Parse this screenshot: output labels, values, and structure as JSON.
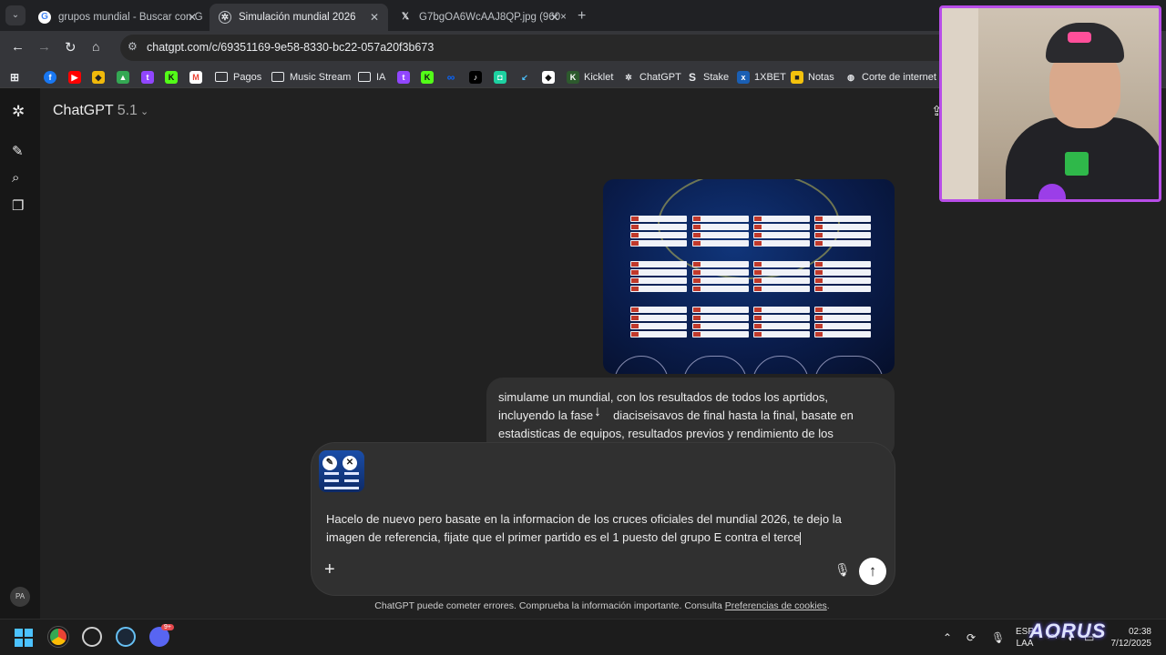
{
  "tabs": [
    {
      "title": "grupos mundial - Buscar con G",
      "favicon": "google-icon"
    },
    {
      "title": "Simulación mundial 2026",
      "favicon": "chatgpt-icon"
    },
    {
      "title": "G7bgOA6WcAAJ8QP.jpg (960×",
      "favicon": "x-icon"
    }
  ],
  "address_bar": {
    "url": "chatgpt.com/c/69351169-9e58-8330-bc22-057a20f3b673"
  },
  "bookmarks": [
    {
      "label": "Pagos",
      "icon": "folder-icon"
    },
    {
      "label": "Music Stream",
      "icon": "folder-icon"
    },
    {
      "label": "IA",
      "icon": "folder-icon"
    },
    {
      "label": "Kicklet",
      "icon": "kicklet-icon"
    },
    {
      "label": "ChatGPT",
      "icon": "chatgpt-icon"
    },
    {
      "label": "Stake",
      "icon": "stake-icon"
    },
    {
      "label": "1XBET",
      "icon": "1xbet-icon"
    },
    {
      "label": "Notas",
      "icon": "notes-icon"
    },
    {
      "label": "Corte de internet st",
      "icon": "globe-icon"
    }
  ],
  "header": {
    "app_name": "ChatGPT",
    "model_version": "5.1"
  },
  "sidebar": {
    "avatar_initials": "PA"
  },
  "user_message": {
    "text": "simulame un mundial, con los resultados de todos los aprtidos, incluyendo la fase de dieciseisavos de final hasta la final, basate en estadisticas de equipos, resultados previos y rendimiento de los",
    "line1": "simulame un mundial, con los resultados de todos los aprtidos,",
    "line2a": "incluyendo la fase",
    "line2b": "diaciseisavos de final hasta la final, basate en",
    "line3": "estadisticas de equipos, resultados previos y rendimiento de los"
  },
  "composer": {
    "text": "Hacelo de nuevo pero basate en la informacion de los cruces oficiales del mundial 2026, te dejo la imagen de referencia, fijate que el primer partido es el 1 puesto del grupo E contra el terce"
  },
  "disclaimer": {
    "text": "ChatGPT puede cometer errores. Comprueba la información importante. Consulta ",
    "link": "Preferencias de cookies",
    "end": "."
  },
  "taskbar": {
    "language_line1": "ESP",
    "language_line2": "LAA",
    "time": "02:38",
    "date": "7/12/2025",
    "badge_count": "9+",
    "brand": "AORUS"
  },
  "colors": {
    "webcam_border": "#b84de8",
    "send_button": "#ffffff",
    "page_bg": "#212121"
  }
}
